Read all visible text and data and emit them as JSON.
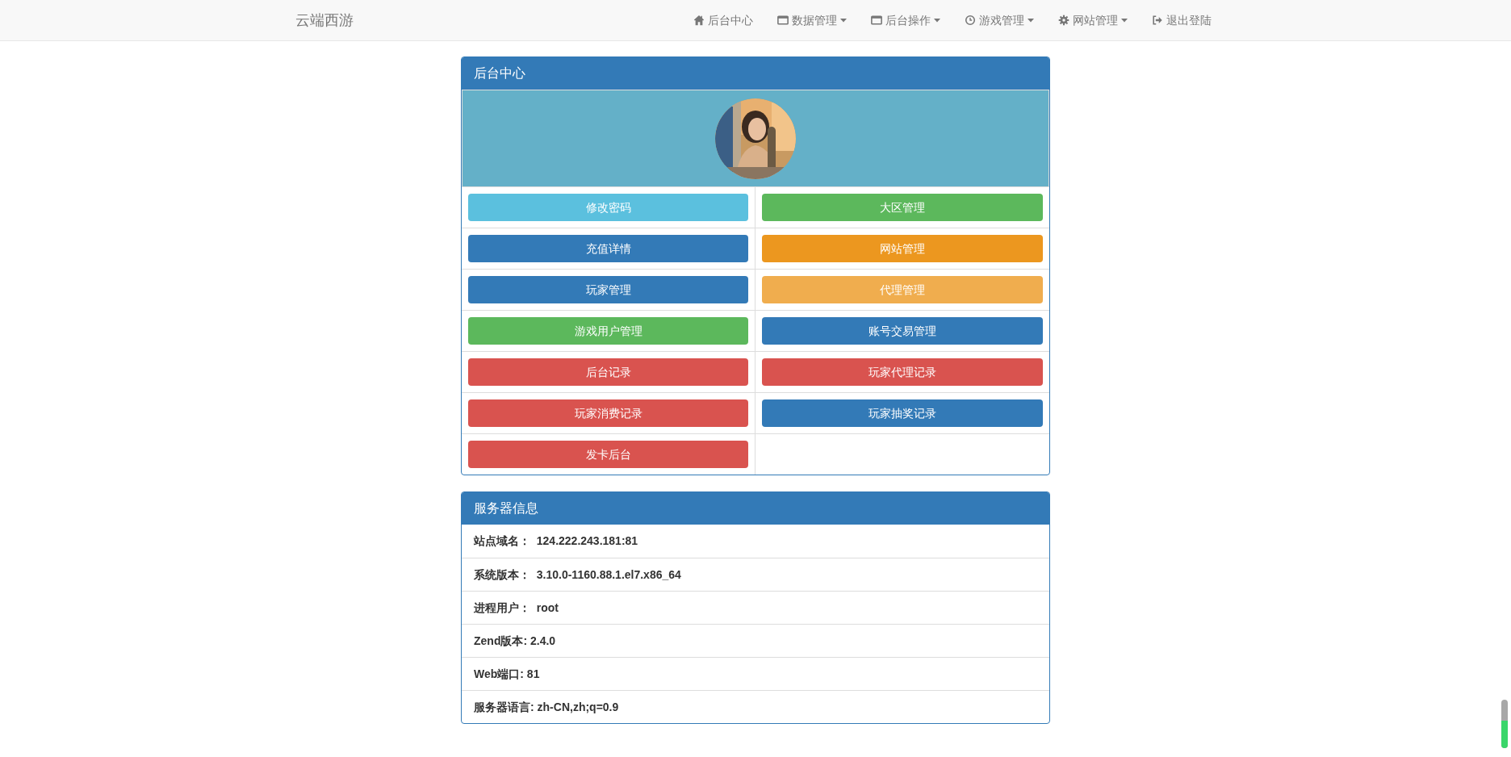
{
  "navbar": {
    "brand": "云端西游",
    "items": [
      {
        "label": "后台中心",
        "dropdown": false
      },
      {
        "label": "数据管理",
        "dropdown": true
      },
      {
        "label": "后台操作",
        "dropdown": true
      },
      {
        "label": "游戏管理",
        "dropdown": true
      },
      {
        "label": "网站管理",
        "dropdown": true
      },
      {
        "label": "退出登陆",
        "dropdown": false
      }
    ]
  },
  "admin_panel": {
    "title": "后台中心",
    "buttons": [
      {
        "label": "修改密码",
        "color": "#5bc0de"
      },
      {
        "label": "大区管理",
        "color": "#5cb85c"
      },
      {
        "label": "充值详情",
        "color": "#337ab7"
      },
      {
        "label": "网站管理",
        "color": "#ec971f"
      },
      {
        "label": "玩家管理",
        "color": "#337ab7"
      },
      {
        "label": "代理管理",
        "color": "#f0ad4e"
      },
      {
        "label": "游戏用户管理",
        "color": "#5cb85c"
      },
      {
        "label": "账号交易管理",
        "color": "#337ab7"
      },
      {
        "label": "后台记录",
        "color": "#d9534f"
      },
      {
        "label": "玩家代理记录",
        "color": "#d9534f"
      },
      {
        "label": "玩家消费记录",
        "color": "#d9534f"
      },
      {
        "label": "玩家抽奖记录",
        "color": "#337ab7"
      },
      {
        "label": "发卡后台",
        "color": "#d9534f"
      }
    ]
  },
  "server_panel": {
    "title": "服务器信息",
    "rows": [
      "站点域名：  124.222.243.181:81",
      "系统版本：  3.10.0-1160.88.1.el7.x86_64",
      "进程用户：  root",
      "Zend版本: 2.4.0",
      "Web端口: 81",
      "服务器语言: zh-CN,zh;q=0.9"
    ]
  }
}
